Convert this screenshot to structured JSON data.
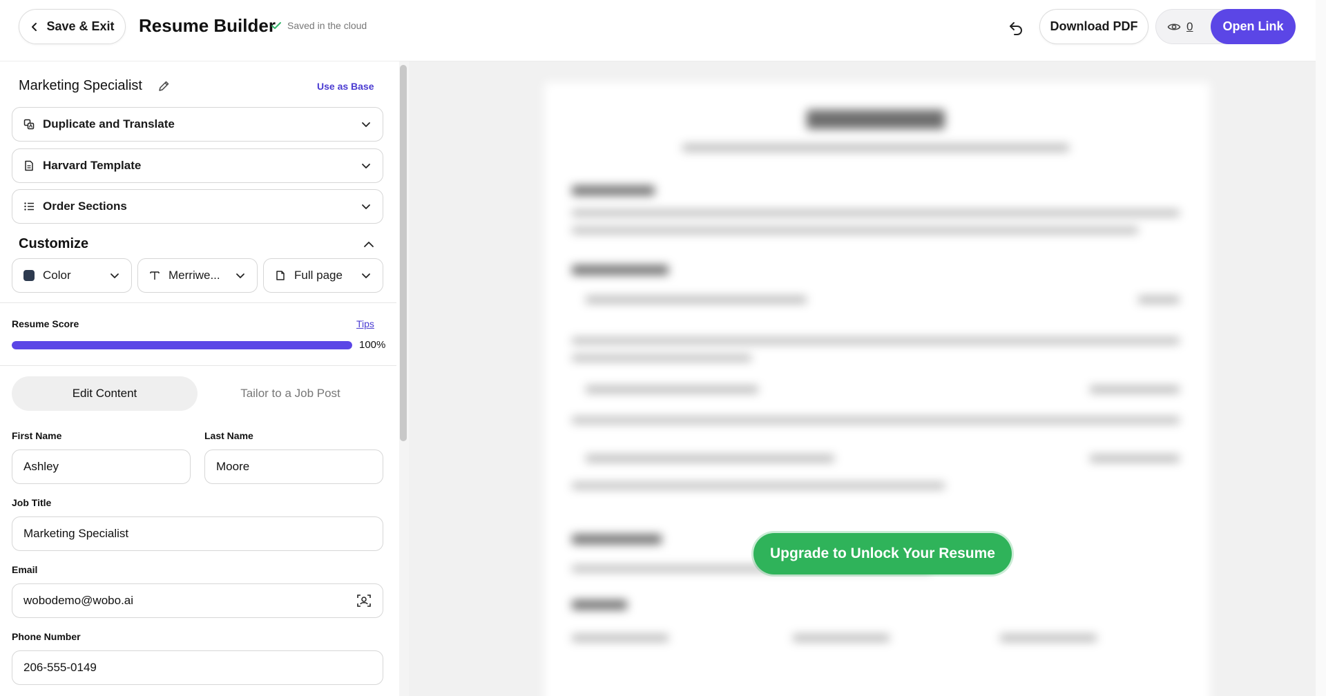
{
  "header": {
    "save_exit_label": "Save & Exit",
    "title": "Resume Builder",
    "saved_status": "Saved in the cloud",
    "download_label": "Download PDF",
    "views_count": "0",
    "open_link_label": "Open Link"
  },
  "sidebar": {
    "resume_name": "Marketing Specialist",
    "use_as_base": "Use as Base",
    "accordions": [
      {
        "label": "Duplicate and Translate",
        "icon": "translate-icon"
      },
      {
        "label": "Harvard Template",
        "icon": "document-icon"
      },
      {
        "label": "Order Sections",
        "icon": "list-icon"
      }
    ],
    "customize": {
      "title": "Customize",
      "color_label": "Color",
      "color_value": "#2d3a4f",
      "font_label": "Merriwe...",
      "page_label": "Full page"
    },
    "score": {
      "label": "Resume Score",
      "tips": "Tips",
      "value": 100,
      "percent_text": "100%"
    },
    "tabs": [
      "Edit Content",
      "Tailor to a Job Post"
    ],
    "fields": {
      "first_name": {
        "label": "First Name",
        "value": "Ashley"
      },
      "last_name": {
        "label": "Last Name",
        "value": "Moore"
      },
      "job_title": {
        "label": "Job Title",
        "value": "Marketing Specialist"
      },
      "email": {
        "label": "Email",
        "value": "wobodemo@wobo.ai"
      },
      "phone": {
        "label": "Phone Number",
        "value": "206-555-0149"
      }
    }
  },
  "preview": {
    "upgrade_label": "Upgrade to Unlock Your Resume"
  },
  "colors": {
    "accent": "#5b46e6",
    "upgrade": "#2fb35a"
  }
}
